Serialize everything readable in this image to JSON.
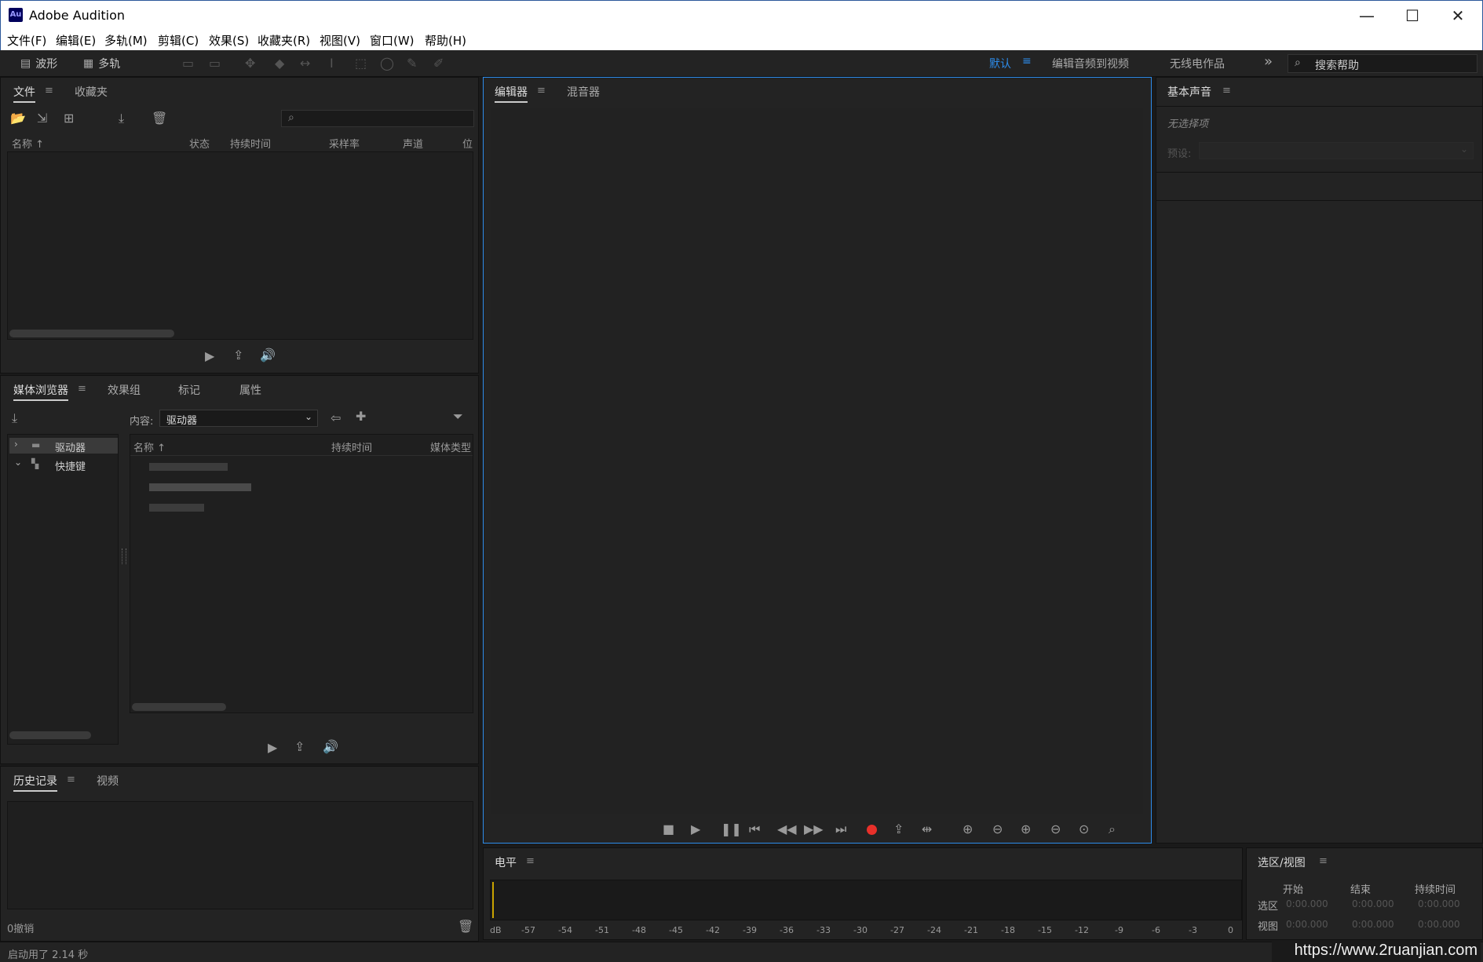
{
  "app": {
    "logo": "Au",
    "title": "Adobe Audition",
    "controls": {
      "minimize": "—",
      "maximize": "☐",
      "close": "✕"
    }
  },
  "menu": [
    "文件(F)",
    "编辑(E)",
    "多轨(M)",
    "剪辑(C)",
    "效果(S)",
    "收藏夹(R)",
    "视图(V)",
    "窗口(W)",
    "帮助(H)"
  ],
  "toolbar": {
    "waveform_label": "波形",
    "multitrack_label": "多轨",
    "workspaces": [
      "默认",
      "编辑音频到视频",
      "无线电作品"
    ],
    "more": "»",
    "search_placeholder": "搜索帮助"
  },
  "files_panel": {
    "tabs": [
      "文件",
      "收藏夹"
    ],
    "columns": [
      "名称 ↑",
      "状态",
      "持续时间",
      "采样率",
      "声道",
      "位"
    ]
  },
  "media_browser": {
    "tabs": [
      "媒体浏览器",
      "效果组",
      "标记",
      "属性"
    ],
    "content_label": "内容:",
    "content_value": "驱动器",
    "tree": [
      "驱动器",
      "快捷键"
    ],
    "columns": [
      "名称 ↑",
      "持续时间",
      "媒体类型"
    ]
  },
  "history_panel": {
    "tabs": [
      "历史记录",
      "视频"
    ],
    "undo_count": "0撤销"
  },
  "status_bar": {
    "startup": "启动用了 2.14 秒"
  },
  "editor_panel": {
    "tabs": [
      "编辑器",
      "混音器"
    ]
  },
  "essential_sound": {
    "title": "基本声音",
    "no_selection": "无选择项",
    "preset_label": "预设:"
  },
  "levels_panel": {
    "title": "电平",
    "scale": [
      "dB",
      "-57",
      "-54",
      "-51",
      "-48",
      "-45",
      "-42",
      "-39",
      "-36",
      "-33",
      "-30",
      "-27",
      "-24",
      "-21",
      "-18",
      "-15",
      "-12",
      "-9",
      "-6",
      "-3",
      "0"
    ]
  },
  "selection_view": {
    "title": "选区/视图",
    "columns": [
      "开始",
      "结束",
      "持续时间"
    ],
    "rows": [
      {
        "label": "选区",
        "start": "0:00.000",
        "end": "0:00.000",
        "duration": "0:00.000"
      },
      {
        "label": "视图",
        "start": "0:00.000",
        "end": "0:00.000",
        "duration": "0:00.000"
      }
    ]
  },
  "watermark": "https://www.2ruanjian.com",
  "colors": {
    "accent": "#2d8ceb",
    "record": "#e8302a",
    "panel_bg": "#232323"
  }
}
